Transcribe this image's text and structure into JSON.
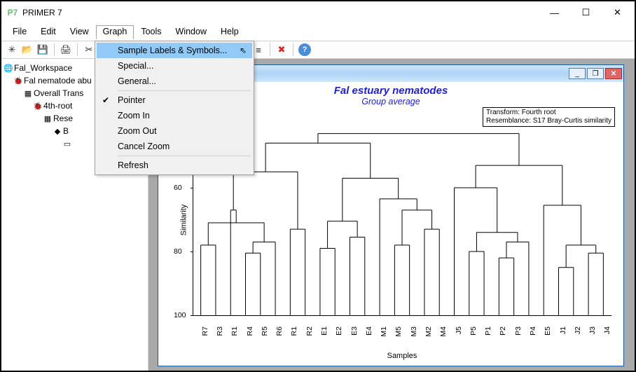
{
  "app": {
    "title": "PRIMER 7",
    "icon": "P7"
  },
  "window_controls": {
    "min": "—",
    "max": "☐",
    "close": "✕"
  },
  "menu": [
    "File",
    "Edit",
    "View",
    "Graph",
    "Tools",
    "Window",
    "Help"
  ],
  "menu_open": "Graph",
  "dropdown": {
    "highlighted": 0,
    "groups": [
      [
        "Sample Labels & Symbols...",
        "Special...",
        "General..."
      ],
      [
        "Pointer",
        "Zoom In",
        "Zoom Out",
        "Cancel Zoom"
      ],
      [
        "Refresh"
      ]
    ],
    "checked": "Pointer"
  },
  "toolbar": {
    "groups": [
      [
        "sparkle-icon",
        "folder-open-icon",
        "save-icon"
      ],
      [
        "print-icon"
      ],
      [
        "cut-icon",
        "copy-icon",
        "paste-icon"
      ],
      [
        "undo-icon",
        "rename-icon",
        "tree-icon-tb"
      ],
      [
        "find-icon",
        "filter-icon",
        "sort-flag-icon",
        "sort-icon",
        "rank-icon"
      ],
      [
        "delete-icon"
      ],
      [
        "help-icon"
      ]
    ],
    "glyphs": {
      "sparkle-icon": "✳",
      "folder-open-icon": "📂",
      "save-icon": "💾",
      "print-icon": "🖨",
      "cut-icon": "✂",
      "copy-icon": "⧉",
      "paste-icon": "📋",
      "undo-icon": "↶",
      "rename-icon": "✎",
      "tree-icon-tb": "🌳",
      "find-icon": "🔍",
      "filter-icon": "⫿",
      "sort-flag-icon": "⚑",
      "sort-icon": "⇵",
      "rank-icon": "≡",
      "delete-icon": "✖",
      "help-icon": "?"
    }
  },
  "tree": [
    {
      "indent": 0,
      "icon": "🌐",
      "label": "Fal_Workspace"
    },
    {
      "indent": 1,
      "icon": "🐞",
      "label": "Fal nematode abu"
    },
    {
      "indent": 2,
      "icon": "▦",
      "label": "Overall Trans"
    },
    {
      "indent": 3,
      "icon": "🐞",
      "label": "4th-root"
    },
    {
      "indent": 4,
      "icon": "▦",
      "label": "Rese"
    },
    {
      "indent": 5,
      "icon": "◆",
      "label": "B"
    },
    {
      "indent": 6,
      "icon": "▭",
      "label": ""
    }
  ],
  "chart_window": {
    "controls": {
      "min": "_",
      "max": "❐",
      "close": "✕"
    }
  },
  "chart_data": {
    "type": "dendrogram",
    "title": "Fal estuary nematodes",
    "subtitle": "Group average",
    "ylabel": "Similarity",
    "xlabel": "Samples",
    "ylim": [
      40,
      100
    ],
    "yticks": [
      60,
      80,
      100
    ],
    "info": [
      "Transform: Fourth root",
      "Resemblance: S17 Bray-Curtis similarity"
    ],
    "leaves": [
      "R7",
      "R3",
      "R1",
      "R4",
      "R5",
      "R6",
      "R1",
      "R2",
      "E1",
      "E2",
      "E3",
      "E4",
      "M1",
      "M5",
      "M3",
      "M2",
      "M4",
      "J5",
      "P5",
      "P1",
      "P2",
      "P3",
      "P4",
      "E5",
      "J1",
      "J2",
      "J3",
      "J4"
    ],
    "merges": [
      {
        "a": 0,
        "b": 1,
        "h": 78
      },
      {
        "a": 3,
        "b": 4,
        "h": 80.5
      },
      {
        "a": "m1",
        "b": 5,
        "h": 77
      },
      {
        "a": "m0",
        "b": "m2",
        "h": 71
      },
      {
        "a": 2,
        "b": "m3",
        "h": 67
      },
      {
        "a": 6,
        "b": 7,
        "h": 73
      },
      {
        "a": "m4",
        "b": "m5",
        "h": 55
      },
      {
        "a": 8,
        "b": 9,
        "h": 79
      },
      {
        "a": 10,
        "b": 11,
        "h": 75.5
      },
      {
        "a": "m7",
        "b": "m8",
        "h": 70.5
      },
      {
        "a": 13,
        "b": 14,
        "h": 78
      },
      {
        "a": 15,
        "b": 16,
        "h": 73
      },
      {
        "a": "m10",
        "b": "m11",
        "h": 67
      },
      {
        "a": 12,
        "b": "m12",
        "h": 63.5
      },
      {
        "a": "m9",
        "b": "m13",
        "h": 57
      },
      {
        "a": "m6",
        "b": "m14",
        "h": 46
      },
      {
        "a": 18,
        "b": 19,
        "h": 80
      },
      {
        "a": 20,
        "b": 21,
        "h": 82
      },
      {
        "a": "m17",
        "b": 22,
        "h": 77
      },
      {
        "a": "m16",
        "b": "m18",
        "h": 74
      },
      {
        "a": 17,
        "b": "m19",
        "h": 60
      },
      {
        "a": 24,
        "b": 25,
        "h": 85
      },
      {
        "a": 26,
        "b": 27,
        "h": 80.5
      },
      {
        "a": "m21",
        "b": "m22",
        "h": 78
      },
      {
        "a": 23,
        "b": "m23",
        "h": 65.5
      },
      {
        "a": "m20",
        "b": "m24",
        "h": 53
      },
      {
        "a": "m15",
        "b": "m25",
        "h": 43
      }
    ]
  }
}
